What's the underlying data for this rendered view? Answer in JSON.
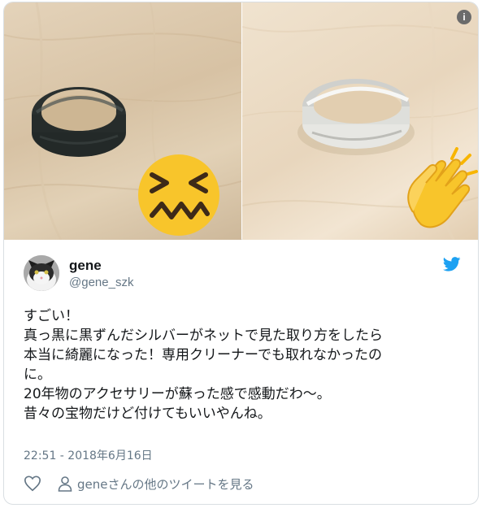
{
  "media": {
    "left_emoji": "confounded-face-emoji",
    "right_emoji": "clapping-hands-emoji",
    "info_label": "i"
  },
  "tweet": {
    "author_name": "gene",
    "author_handle": "@gene_szk",
    "text_lines": [
      "すごい！",
      "真っ黒に黒ずんだシルバーがネットで見た取り方をしたら",
      "本当に綺麗になった！専用クリーナーでも取れなかったの",
      "に。",
      "20年物のアクセサリーが蘇った感で感動だわ〜。",
      "昔々の宝物だけど付けてもいいやんね。"
    ],
    "timestamp": "22:51 - 2018年6月16日",
    "view_more": "geneさんの他のツイートを見る"
  },
  "colors": {
    "accent": "#1da1f2",
    "secondary_text": "#657786",
    "primary_text": "#14171a",
    "emoji_yellow": "#f8c52b"
  }
}
